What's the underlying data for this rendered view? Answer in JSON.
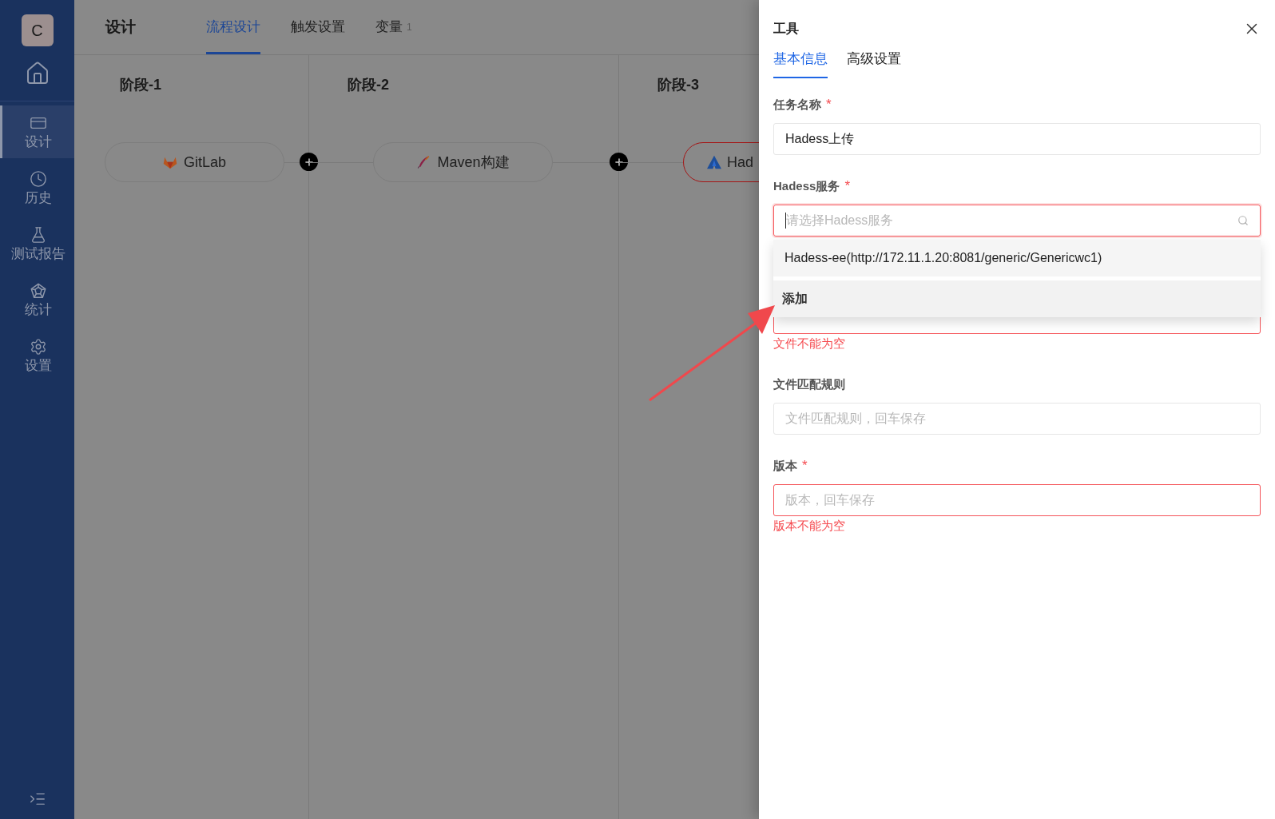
{
  "sidebar": {
    "avatar": "C",
    "items": [
      {
        "label": "设计",
        "selected": true
      },
      {
        "label": "历史",
        "selected": false
      },
      {
        "label": "测试报告",
        "selected": false
      },
      {
        "label": "统计",
        "selected": false
      },
      {
        "label": "设置",
        "selected": false
      }
    ]
  },
  "header": {
    "title": "设计",
    "tabs": [
      {
        "label": "流程设计",
        "selected": true
      },
      {
        "label": "触发设置",
        "selected": false
      },
      {
        "label": "变量",
        "count": "1",
        "selected": false
      }
    ]
  },
  "stages": [
    {
      "title": "阶段-1",
      "task": {
        "name": "GitLab",
        "invalid": false
      }
    },
    {
      "title": "阶段-2",
      "task": {
        "name": "Maven构建",
        "invalid": false
      }
    },
    {
      "title": "阶段-3",
      "task": {
        "name": "Had",
        "invalid": true
      }
    }
  ],
  "panel": {
    "title": "工具",
    "tabs": [
      {
        "label": "基本信息",
        "selected": true
      },
      {
        "label": "高级设置",
        "selected": false
      }
    ],
    "fields": [
      {
        "kind": "input",
        "label": "任务名称",
        "required_mark": "*",
        "value": "Hadess上传",
        "invalid": false
      },
      {
        "kind": "select",
        "label": "Hadess服务",
        "required_mark": "*",
        "placeholder": "请选择Hadess服务",
        "invalid": true,
        "options": [
          {
            "kind": "option",
            "label": "Hadess-ee(http://172.11.1.20:8081/generic/Genericwc1)"
          },
          {
            "kind": "action",
            "label": "添加"
          }
        ]
      },
      {
        "kind": "input",
        "invalid": true,
        "error": "文件不能为空"
      },
      {
        "kind": "input",
        "label": "文件匹配规则",
        "placeholder": "文件匹配规则，回车保存",
        "invalid": false
      },
      {
        "kind": "input",
        "label": "版本",
        "required_mark": "*",
        "placeholder": "版本，回车保存",
        "invalid": true,
        "error": "版本不能为空"
      }
    ]
  }
}
